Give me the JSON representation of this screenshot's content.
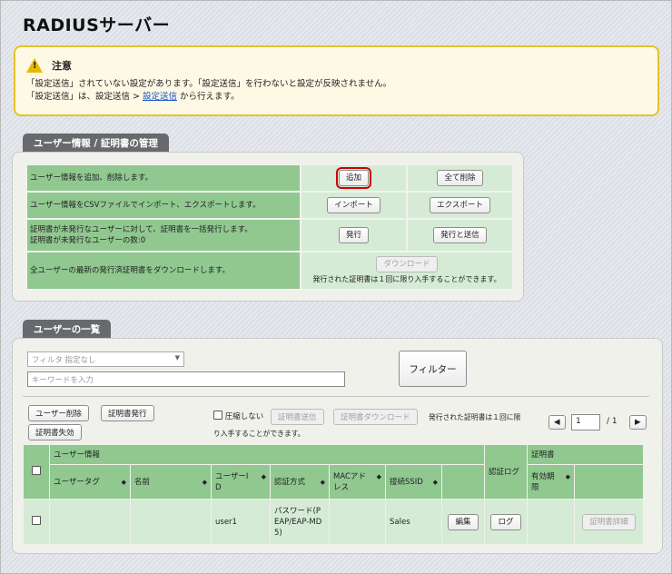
{
  "page": {
    "title": "RADIUSサーバー"
  },
  "notice": {
    "heading": "注意",
    "line1": "「設定送信」されていない設定があります。「設定送信」を行わないと設定が反映されません。",
    "line2_prefix": "「設定送信」は、設定送信 > ",
    "line2_link": "設定送信",
    "line2_suffix": " から行えます。"
  },
  "management": {
    "title": "ユーザー情報 / 証明書の管理",
    "row1": {
      "label": "ユーザー情報を追加、削除します。",
      "add": "追加",
      "delete_all": "全て削除"
    },
    "row2": {
      "label": "ユーザー情報をCSVファイルでインポート、エクスポートします。",
      "import": "インポート",
      "export": "エクスポート"
    },
    "row3": {
      "label1": "証明書が未発行なユーザーに対して、証明書を一括発行します。",
      "label2": "証明書が未発行なユーザーの数:0",
      "issue": "発行",
      "issue_send": "発行と送信"
    },
    "row4": {
      "label": "全ユーザーの最新の発行済証明書をダウンロードします。",
      "download": "ダウンロード",
      "note": "発行された証明書は１回に限り入手することができます。"
    }
  },
  "userlist": {
    "title": "ユーザーの一覧",
    "filter_placeholder": "フィルタ 指定なし",
    "keyword_placeholder": "キーワードを入力",
    "filter_button": "フィルター",
    "buttons": {
      "delete_user": "ユーザー削除",
      "issue_cert": "証明書発行",
      "revoke_cert": "証明書失効",
      "no_compress": "圧縮しない",
      "send_cert": "証明書送信",
      "download_cert": "証明書ダウンロード"
    },
    "download_note1": "発行された証明書は１回に限",
    "download_note2": "り入手することができます。",
    "pagination": {
      "page": "1",
      "total": "/ 1"
    },
    "headers": {
      "user_info": "ユーザー情報",
      "user_tag": "ユーザータグ",
      "name": "名前",
      "user_id1": "ユーザーI",
      "user_id2": "D",
      "auth_method": "認証方式",
      "mac1": "MACアド",
      "mac2": "レス",
      "ssid": "接続SSID",
      "auth_log": "認証ログ",
      "cert": "証明書",
      "valid1": "有効期",
      "valid2": "限"
    },
    "row": {
      "user_tag": "",
      "name": "",
      "user_id": "user1",
      "auth1": "パスワード(P",
      "auth2": "EAP/EAP-MD",
      "auth3": "5)",
      "mac": "",
      "ssid": "Sales",
      "edit": "編集",
      "log": "ログ",
      "valid": "",
      "cert_detail": "証明書詳細"
    }
  }
}
